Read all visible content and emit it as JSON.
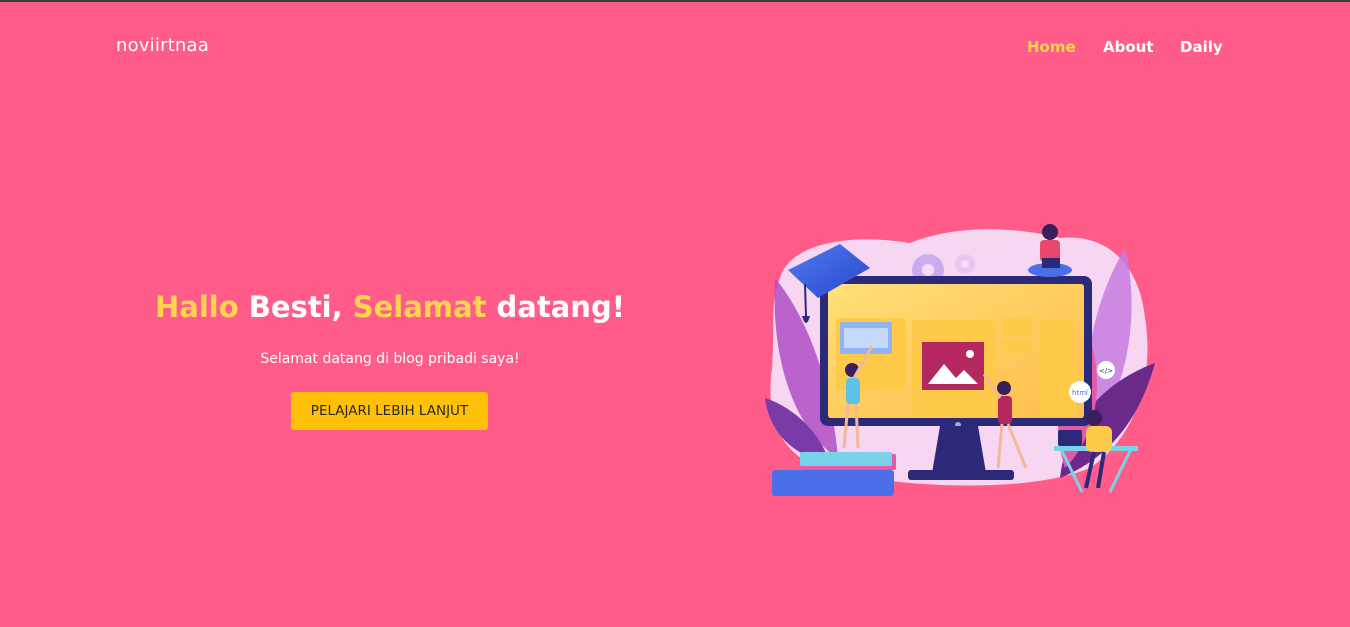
{
  "header": {
    "brand": "noviirtnaa",
    "nav": [
      {
        "label": "Home",
        "active": true
      },
      {
        "label": "About",
        "active": false
      },
      {
        "label": "Daily",
        "active": false
      }
    ]
  },
  "hero": {
    "title_parts": [
      "Hallo",
      " Besti, ",
      "Selamat",
      " datang!"
    ],
    "subtitle": "Selamat datang di blog pribadi saya!",
    "cta_label": "PELAJARI LEBIH LANJUT"
  },
  "illustration": {
    "html_tag": "html",
    "code_tag": "</>"
  },
  "colors": {
    "background": "#ff5c8a",
    "accent": "#ffd54f",
    "button": "#ffc107",
    "text": "#ffffff"
  }
}
